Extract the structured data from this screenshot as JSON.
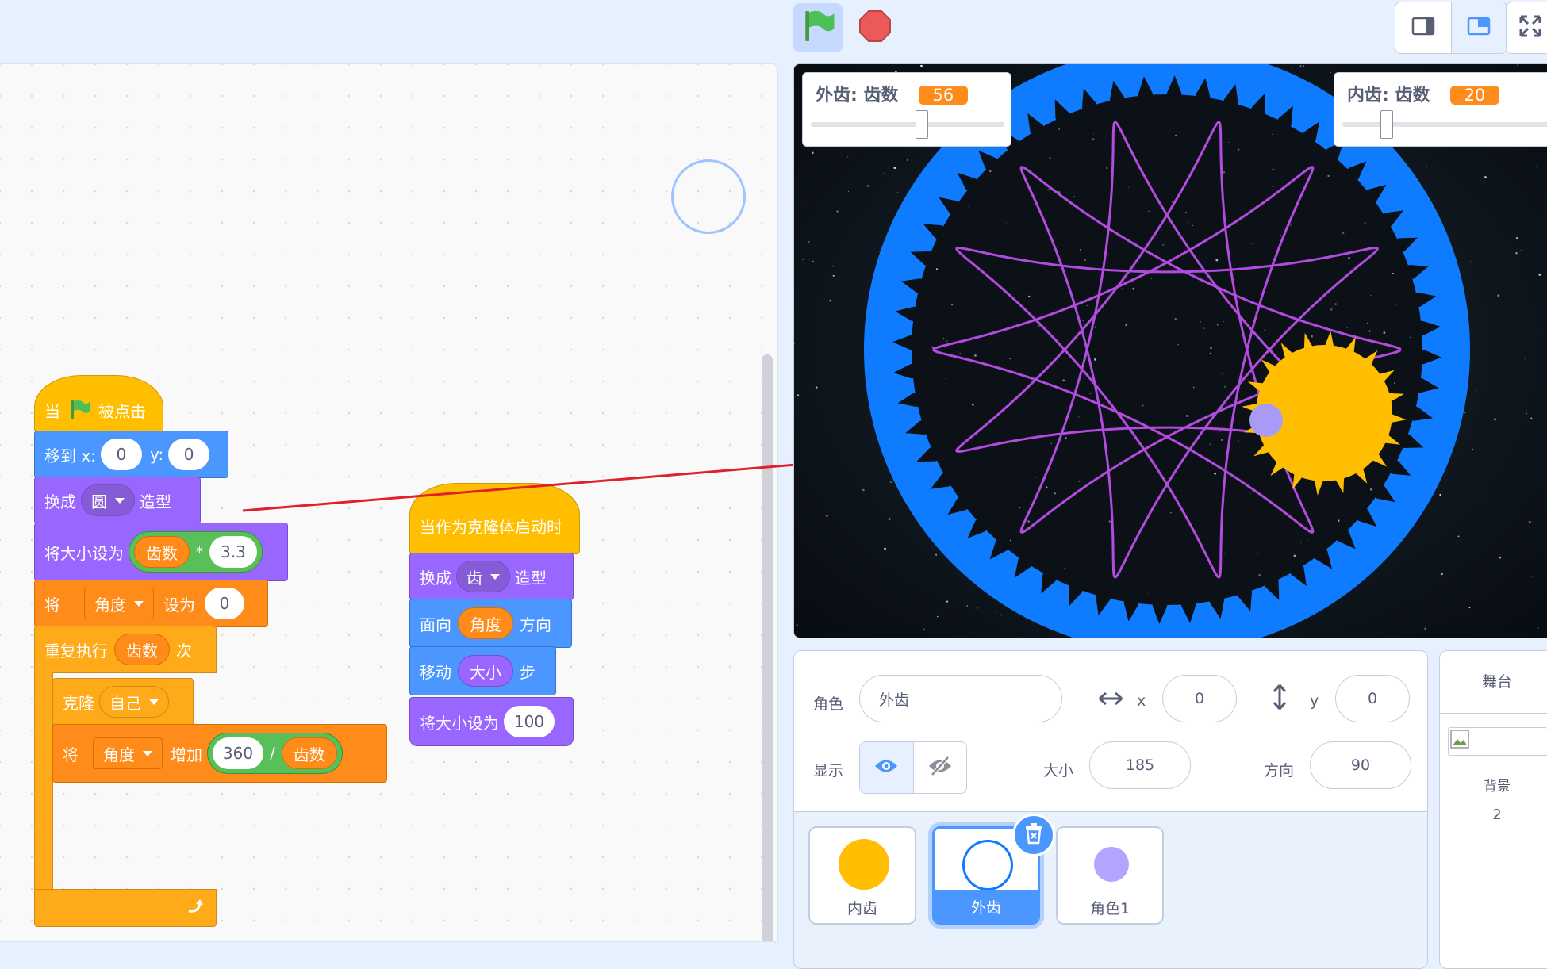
{
  "controls": {
    "green_flag": "green-flag-icon",
    "stop": "stop-icon",
    "modes": [
      "small-stage-icon",
      "large-stage-icon",
      "fullscreen-icon"
    ]
  },
  "script1": {
    "hat": {
      "when": "当",
      "clicked": "被点击"
    },
    "goto": {
      "label": "移到 x:",
      "x": "0",
      "y_label": "y:",
      "y": "0"
    },
    "switch_costume": {
      "label": "换成",
      "costume": "圆",
      "suffix": "造型"
    },
    "set_size": {
      "label": "将大小设为",
      "var": "齿数",
      "op": "*",
      "value": "3.3"
    },
    "set_var": {
      "label": "将",
      "var": "角度",
      "mid": "设为",
      "value": "0"
    },
    "repeat": {
      "label": "重复执行",
      "var": "齿数",
      "suffix": "次"
    },
    "clone": {
      "label": "克隆",
      "target": "自己"
    },
    "change_var": {
      "label": "将",
      "var": "角度",
      "mid": "增加",
      "left": "360",
      "op": "/",
      "right": "齿数"
    }
  },
  "script2": {
    "hat": "当作为克隆体启动时",
    "switch_costume": {
      "label": "换成",
      "costume": "齿",
      "suffix": "造型"
    },
    "point": {
      "label": "面向",
      "var": "角度",
      "suffix": "方向"
    },
    "move": {
      "label": "移动",
      "var": "大小",
      "suffix": "步"
    },
    "set_size": {
      "label": "将大小设为",
      "value": "100"
    }
  },
  "monitors": {
    "outer": {
      "label": "外齿: 齿数",
      "value": "56",
      "slider_level": 0.55
    },
    "inner": {
      "label": "内齿: 齿数",
      "value": "20",
      "slider_level": 0.25
    }
  },
  "sprite_info": {
    "name_label": "角色",
    "name": "外齿",
    "x_label": "x",
    "x": "0",
    "y_label": "y",
    "y": "0",
    "show_label": "显示",
    "size_label": "大小",
    "size": "185",
    "direction_label": "方向",
    "direction": "90"
  },
  "sprites": [
    {
      "name": "内齿",
      "color": "#ffbf00"
    },
    {
      "name": "外齿",
      "color": "#ffffff"
    },
    {
      "name": "角色1",
      "color": "#b3a4ff"
    }
  ],
  "stage_panel": {
    "title": "舞台",
    "backdrops_label": "背景",
    "backdrops_count": "2"
  },
  "colors": {
    "events": "#ffbf00",
    "motion": "#4c97ff",
    "looks": "#9966ff",
    "variables": "#ff8c1a",
    "control": "#ffab19",
    "operators": "#59c059",
    "trace": "#b44be0",
    "gear_outer": "#0f7bff"
  }
}
